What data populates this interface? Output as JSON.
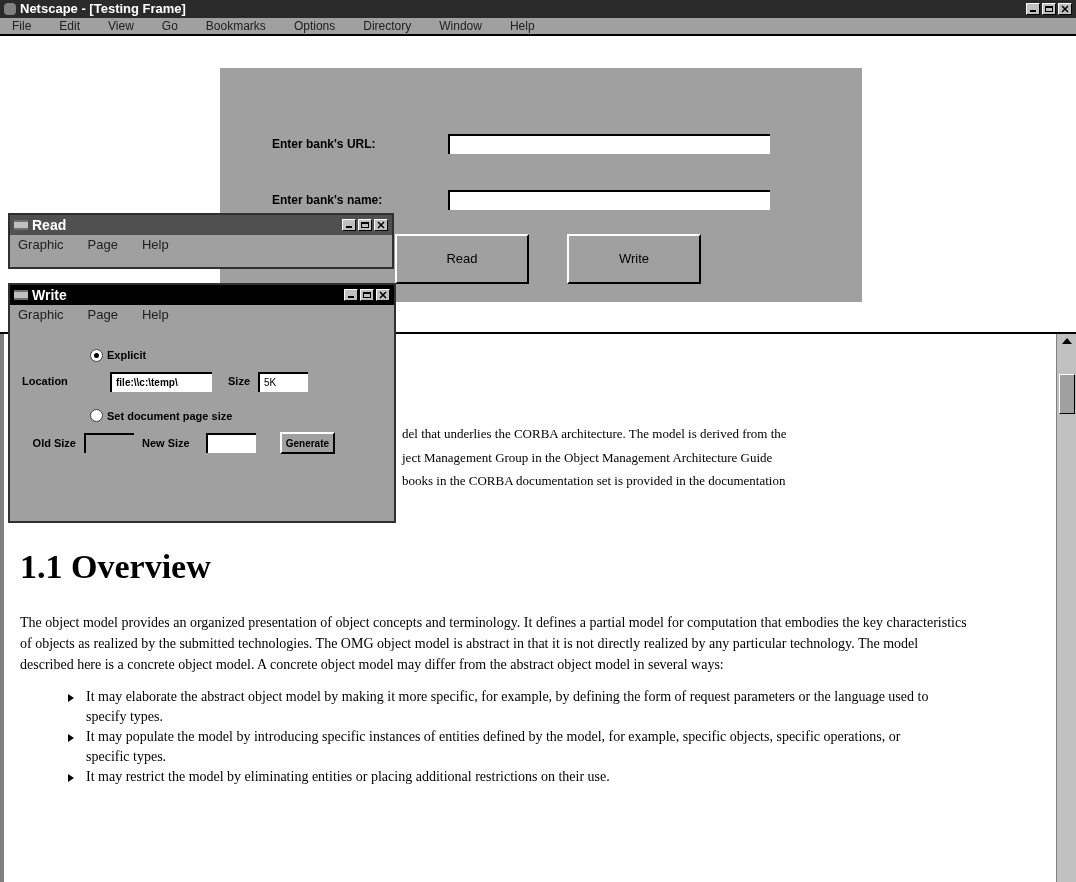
{
  "window": {
    "title": "Netscape - [Testing Frame]"
  },
  "menu": [
    "File",
    "Edit",
    "View",
    "Go",
    "Bookmarks",
    "Options",
    "Directory",
    "Window",
    "Help"
  ],
  "form": {
    "fields": [
      {
        "label": "Enter bank's URL:"
      },
      {
        "label": "Enter bank's name:"
      }
    ],
    "buttons": [
      "Read",
      "Write"
    ]
  },
  "read_window": {
    "title": "Read",
    "menu": [
      "Graphic",
      "Page",
      "Help"
    ]
  },
  "write_window": {
    "title": "Write",
    "menu": [
      "Graphic",
      "Page",
      "Help"
    ],
    "options": [
      {
        "label": "Explicit",
        "selected": true
      },
      {
        "label": "Set document page size",
        "selected": false
      }
    ],
    "location_label": "Location",
    "location_value": "file:\\\\c:\\temp\\",
    "size_label": "Size",
    "size_value": "5K",
    "old_size_label": "Old Size",
    "new_size_label": "New Size",
    "button": "Generate"
  },
  "document": {
    "intro_lines": [
      "del that underlies the CORBA architecture. The model is derived from the",
      "ject Management Group in the Object Management Architecture Guide",
      "books in the CORBA documentation set is provided in the documentation"
    ],
    "heading": "1.1 Overview",
    "paragraph": "The object model provides an organized presentation of object concepts and terminology. It defines a partial model for computation that embodies the key characteristics of objects as realized by the submitted technologies. The OMG object model is abstract in that it is not directly realized by any particular technology. The model described here is a concrete object model. A concrete object model may differ from the abstract object model in several ways:",
    "bullets": [
      "It may elaborate the abstract object model by making it more specific, for example, by defining the form of request parameters or the language used to specify types.",
      "It may populate the model by introducing specific instances of entities defined by the model, for example, specific objects, specific operations, or specific types.",
      "It may restrict the model by eliminating entities or placing additional restrictions on their use."
    ]
  }
}
